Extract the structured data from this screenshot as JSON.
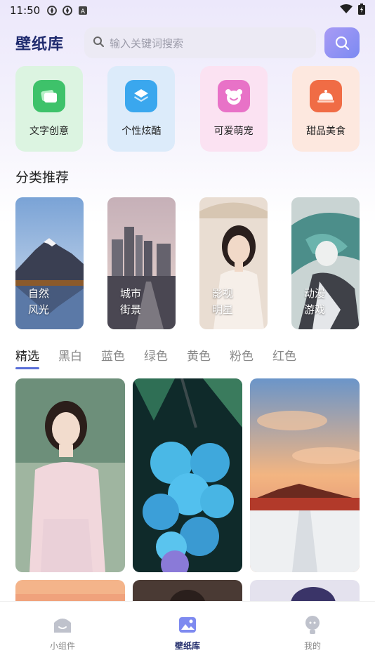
{
  "status": {
    "time": "11:50"
  },
  "app": {
    "logo": "壁纸库"
  },
  "search": {
    "placeholder": "输入关键词搜索"
  },
  "categories": [
    {
      "label": "文字创意",
      "icon": "text-creative-icon",
      "bg": "#dcf4e1",
      "icon_color": "#3ec26a"
    },
    {
      "label": "个性炫酷",
      "icon": "layers-icon",
      "bg": "#dcebfa",
      "icon_color": "#3aa7ee"
    },
    {
      "label": "可爱萌宠",
      "icon": "pet-face-icon",
      "bg": "#fbe2f2",
      "icon_color": "#e872c7"
    },
    {
      "label": "甜品美食",
      "icon": "food-cloche-icon",
      "bg": "#fde8df",
      "icon_color": "#f06c45"
    }
  ],
  "section": {
    "title": "分类推荐"
  },
  "recommendations": [
    {
      "line1": "自然",
      "line2": "风光"
    },
    {
      "line1": "城市",
      "line2": "街景"
    },
    {
      "line1": "影视",
      "line2": "明星"
    },
    {
      "line1": "动漫",
      "line2": "游戏"
    }
  ],
  "color_tabs": [
    "精选",
    "黑白",
    "蓝色",
    "绿色",
    "黄色",
    "粉色",
    "红色"
  ],
  "tabbar": [
    {
      "label": "小组件",
      "icon": "widget-icon",
      "active": false
    },
    {
      "label": "壁纸库",
      "icon": "wallpaper-icon",
      "active": true
    },
    {
      "label": "我的",
      "icon": "profile-icon",
      "active": false
    }
  ],
  "colors": {
    "accent": "#7b8af2",
    "brand": "#1e2a6e"
  }
}
